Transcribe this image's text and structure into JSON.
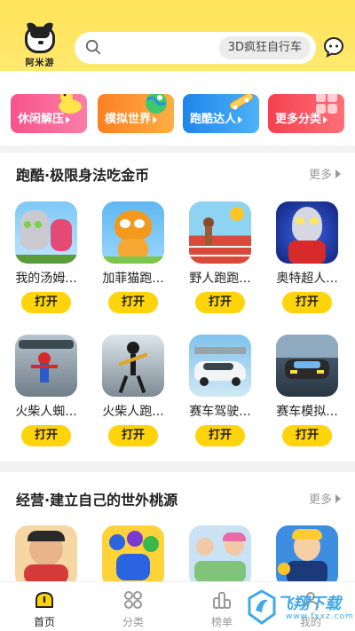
{
  "header": {
    "logo_text": "阿米游",
    "search_chip": "3D疯狂自行车"
  },
  "categories": [
    {
      "label": "休闲解压",
      "color": "#f35d8f",
      "icon": "duck-icon"
    },
    {
      "label": "模拟世界",
      "color": "#fb8c2a",
      "icon": "globe-icon"
    },
    {
      "label": "跑酷达人",
      "color": "#2f95ef",
      "icon": "skateboard-icon"
    },
    {
      "label": "更多分类",
      "color": "#fa4c54",
      "icon": "grid-icon"
    }
  ],
  "sections": [
    {
      "title": "跑酷·极限身法吃金币",
      "more": "更多",
      "games": [
        {
          "name": "我的汤姆...",
          "open": "打开"
        },
        {
          "name": "加菲猫跑...",
          "open": "打开"
        },
        {
          "name": "野人跑跑...",
          "open": "打开"
        },
        {
          "name": "奥特超人...",
          "open": "打开"
        },
        {
          "name": "火柴人蜘...",
          "open": "打开"
        },
        {
          "name": "火柴人跑...",
          "open": "打开"
        },
        {
          "name": "赛车驾驶...",
          "open": "打开"
        },
        {
          "name": "赛车模拟...",
          "open": "打开"
        }
      ]
    },
    {
      "title": "经营·建立自己的世外桃源",
      "more": "更多"
    }
  ],
  "nav": [
    {
      "label": "首页",
      "icon": "home-icon",
      "active": true
    },
    {
      "label": "分类",
      "icon": "category-icon",
      "active": false
    },
    {
      "label": "榜单",
      "icon": "ranking-icon",
      "active": false
    },
    {
      "label": "我的",
      "icon": "profile-icon",
      "active": false
    }
  ],
  "watermark": {
    "text": "飞翔下载",
    "sub": "www.fxxz.com"
  }
}
